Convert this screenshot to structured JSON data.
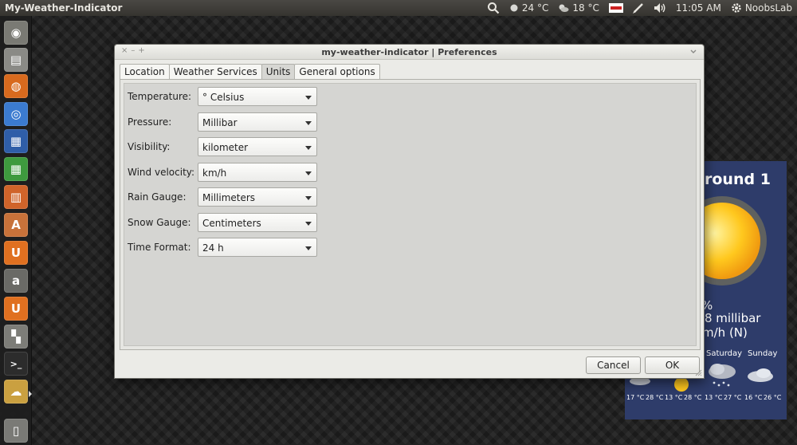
{
  "panel": {
    "app_title": "My-Weather-Indicator",
    "weather_temp_1": "24 °C",
    "weather_temp_2": "18 °C",
    "clock": "11:05 AM",
    "user": "NoobsLab"
  },
  "launcher": {
    "items": [
      {
        "name": "dash-home",
        "color": "#7a7a74"
      },
      {
        "name": "files",
        "color": "#8a8a86"
      },
      {
        "name": "firefox",
        "color": "#d86a1e"
      },
      {
        "name": "chromium",
        "color": "#3b7bd0"
      },
      {
        "name": "writer",
        "color": "#2f5ea8"
      },
      {
        "name": "calc",
        "color": "#3e9a3e"
      },
      {
        "name": "impress",
        "color": "#d0642a"
      },
      {
        "name": "software-center",
        "color": "#c8723a"
      },
      {
        "name": "ubuntu-one",
        "color": "#e07020"
      },
      {
        "name": "amazon",
        "color": "#6a6a66"
      },
      {
        "name": "ubuntu-one-music",
        "color": "#e07020"
      },
      {
        "name": "system-settings",
        "color": "#7d7d78"
      },
      {
        "name": "terminal",
        "color": "#2c2c2c"
      },
      {
        "name": "my-weather-indicator",
        "color": "#caa040"
      },
      {
        "name": "trash",
        "color": "#7a7a76"
      }
    ]
  },
  "dialog": {
    "title": "my-weather-indicator | Preferences",
    "window_controls": {
      "close": "×",
      "minimize": "–",
      "maximize": "+"
    },
    "tabs": [
      {
        "label": "Location"
      },
      {
        "label": "Weather Services"
      },
      {
        "label": "Units",
        "active": true
      },
      {
        "label": "General options"
      }
    ],
    "units": [
      {
        "label": "Temperature:",
        "value": "° Celsius"
      },
      {
        "label": "Pressure:",
        "value": "Millibar"
      },
      {
        "label": "Visibility:",
        "value": "kilometer"
      },
      {
        "label": "Wind velocity:",
        "value": "km/h"
      },
      {
        "label": "Rain Gauge:",
        "value": "Millimeters"
      },
      {
        "label": "Snow Gauge:",
        "value": "Centimeters"
      },
      {
        "label": "Time Format:",
        "value": "24 h"
      }
    ],
    "cancel_label": "Cancel",
    "ok_label": "OK"
  },
  "weather_widget": {
    "title": "round 1",
    "humidity": "%",
    "pressure": "8 millibar",
    "wind": "m/h (N)",
    "days": [
      {
        "label": "Saturday"
      },
      {
        "label": "Sunday"
      }
    ],
    "temps": [
      "17 °C",
      "28 °C",
      "13 °C",
      "28 °C",
      "13 °C",
      "27 °C",
      "16 °C",
      "26 °C"
    ]
  },
  "colors": {
    "widget_bg": "#2e3c6a",
    "dialog_bg": "#ebebe7"
  }
}
